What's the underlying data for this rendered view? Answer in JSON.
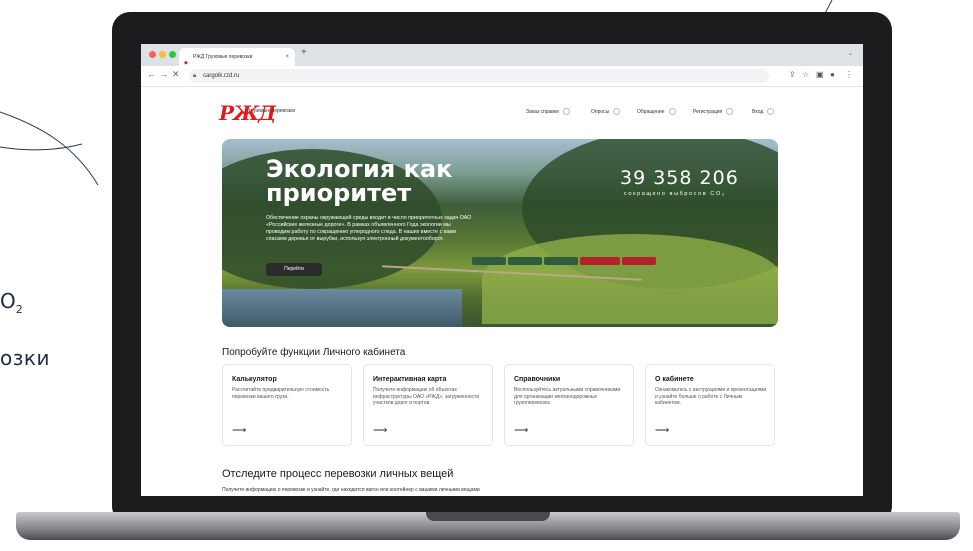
{
  "side": {
    "co2_text": "O",
    "co2_sub": "2",
    "word": "озки"
  },
  "browser": {
    "tab_title": "РЖД Грузовые перевозки",
    "tab_close": "×",
    "new_tab": "+",
    "url": "cargolk.rzd.ru",
    "chevron_icon": "chevron-down-icon"
  },
  "site": {
    "logo": "РЖД",
    "logo_sub": "грузовые перевозки",
    "nav": [
      "Заказ справки",
      "Опросы",
      "Обращение",
      "Регистрация",
      "Вход"
    ]
  },
  "hero": {
    "title_line1": "Экология как",
    "title_line2": "приоритет",
    "description": "Обеспечение охраны окружающей среды входит в число приоритетных задач ОАО «Российские железные дороги». В рамках объявленного Года экологии мы проводим работу по сокращению углеродного следа. В наших вместе с вами спасаем деревья от вырубки, используя электронный документооборот.",
    "button": "Перейти",
    "stat_value": "39 358 206",
    "stat_label": "сокращено выбросов CO₂"
  },
  "features": {
    "title": "Попробуйте функции Личного кабинета",
    "cards": [
      {
        "title": "Калькулятор",
        "text": "Рассчитайте предварительную стоимость перевозки вашего груза.",
        "arrow": "⟶"
      },
      {
        "title": "Интерактивная карта",
        "text": "Получите информацию об объектах инфраструктуры ОАО «РЖД», загруженности участков дорог и портов.",
        "arrow": "⟶"
      },
      {
        "title": "Справочники",
        "text": "Воспользуйтесь актуальными справочниками для организации железнодорожных грузоперевозок.",
        "arrow": "⟶"
      },
      {
        "title": "О кабинете",
        "text": "Ознакомьтесь с инструкциями и презентациями и узнайте больше о работе с Личным кабинетом.",
        "arrow": "⟶"
      }
    ]
  },
  "tracking": {
    "title": "Отследите процесс перевозки личных вещей",
    "subtitle": "Получите информацию о перевозке и узнайте, где находится вагон или контейнер с вашими личными вещами"
  },
  "colors": {
    "brand_red": "#e21a1a",
    "laptop": "#1c1c1e"
  }
}
